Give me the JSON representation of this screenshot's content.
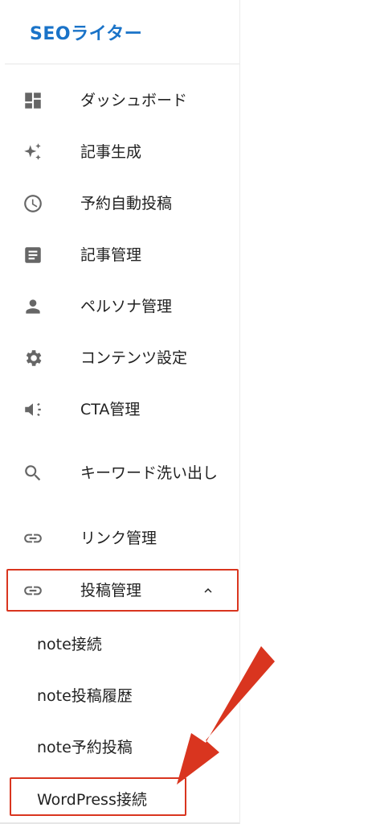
{
  "brand": {
    "title": "SEOライター"
  },
  "nav": {
    "items": [
      {
        "label": "ダッシュボード",
        "icon": "dashboard-icon"
      },
      {
        "label": "記事生成",
        "icon": "sparkle-icon"
      },
      {
        "label": "予約自動投稿",
        "icon": "clock-icon"
      },
      {
        "label": "記事管理",
        "icon": "article-icon"
      },
      {
        "label": "ペルソナ管理",
        "icon": "person-icon"
      },
      {
        "label": "コンテンツ設定",
        "icon": "gear-icon"
      },
      {
        "label": "CTA管理",
        "icon": "megaphone-icon"
      },
      {
        "label": "キーワード洗い出し",
        "icon": "search-icon"
      },
      {
        "label": "リンク管理",
        "icon": "link-icon"
      },
      {
        "label": "投稿管理",
        "icon": "link-icon",
        "expanded": true
      }
    ],
    "subitems": [
      {
        "label": "note接続"
      },
      {
        "label": "note投稿履歴"
      },
      {
        "label": "note予約投稿"
      },
      {
        "label": "WordPress接続"
      }
    ]
  },
  "colors": {
    "accent": "#1a73c8",
    "highlight": "#d9351f",
    "icon": "#666666"
  }
}
